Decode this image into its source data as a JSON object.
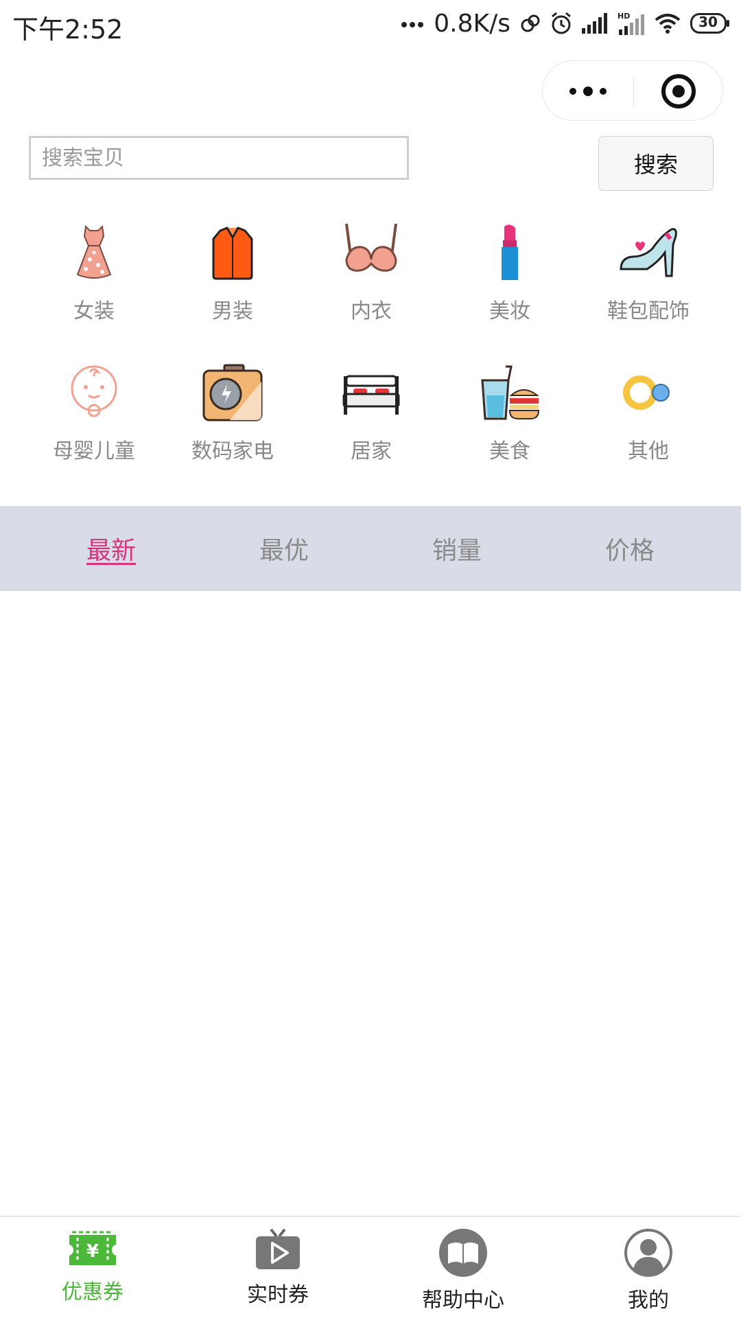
{
  "status_bar": {
    "time": "下午2:52",
    "network_speed": "0.8K/s",
    "battery": "30",
    "icons": [
      "more-dots-icon",
      "sync-icon",
      "alarm-icon",
      "signal-icon",
      "hd-signal-icon",
      "wifi-icon",
      "battery-icon"
    ]
  },
  "capsule": {
    "icons": [
      "more-icon",
      "close-target-icon"
    ]
  },
  "search": {
    "placeholder": "搜索宝贝",
    "value": "",
    "button_label": "搜索"
  },
  "categories": [
    {
      "label": "女装",
      "icon": "dress-icon"
    },
    {
      "label": "男装",
      "icon": "shirt-icon"
    },
    {
      "label": "内衣",
      "icon": "bra-icon"
    },
    {
      "label": "美妆",
      "icon": "lipstick-icon"
    },
    {
      "label": "鞋包配饰",
      "icon": "high-heel-icon"
    },
    {
      "label": "母婴儿童",
      "icon": "baby-icon"
    },
    {
      "label": "数码家电",
      "icon": "camera-icon"
    },
    {
      "label": "居家",
      "icon": "bed-icon"
    },
    {
      "label": "美食",
      "icon": "food-icon"
    },
    {
      "label": "其他",
      "icon": "rings-icon"
    }
  ],
  "sort_tabs": [
    {
      "label": "最新",
      "active": true
    },
    {
      "label": "最优",
      "active": false
    },
    {
      "label": "销量",
      "active": false
    },
    {
      "label": "价格",
      "active": false
    }
  ],
  "bottom_nav": [
    {
      "label": "优惠券",
      "icon": "coupon-icon",
      "active": true
    },
    {
      "label": "实时券",
      "icon": "tv-play-icon",
      "active": false
    },
    {
      "label": "帮助中心",
      "icon": "book-icon",
      "active": false
    },
    {
      "label": "我的",
      "icon": "user-icon",
      "active": false
    }
  ],
  "colors": {
    "accent_active_tab": "#d4357e",
    "accent_nav_active": "#4cb83a",
    "sort_bar_bg": "#d9dce7",
    "label_gray": "#888888"
  }
}
